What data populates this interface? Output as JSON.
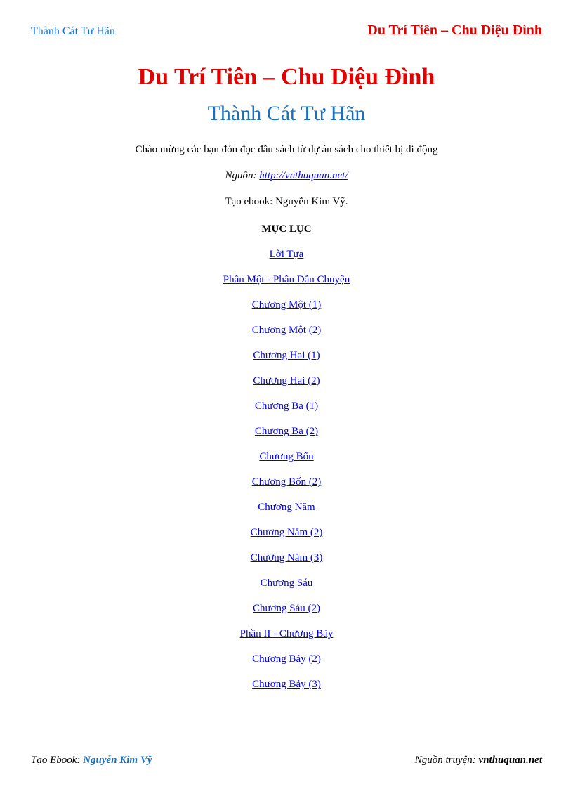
{
  "header": {
    "left": "Thành Cát Tư Hãn",
    "right": "Du Trí Tiên – Chu Diệu Đình"
  },
  "title_main": "Du Trí Tiên – Chu Diệu Đình",
  "title_sub": "Thành Cát Tư Hãn",
  "intro": "Chào mừng các bạn đón đọc đầu sách từ dự án sách cho thiết bị di động",
  "source": {
    "label": "Nguồn: ",
    "url": "http://vnthuquan.net/"
  },
  "creator": "Tạo ebook: Nguyễn Kim Vỹ.",
  "toc_heading": "MỤC LỤC",
  "toc": [
    "Lời Tựa",
    "Phần Một - Phần Dẫn Chuyện",
    "Chương Một (1)",
    "Chương Một (2)",
    "Chương Hai (1)",
    "Chương Hai (2)",
    "Chương Ba (1)",
    "Chương Ba (2)",
    "Chương Bốn",
    "Chương Bốn (2)",
    "Chương Năm",
    "Chương Năm (2)",
    "Chương Năm (3)",
    "Chương Sáu",
    "Chương Sáu (2)",
    "Phần II - Chương Bảy",
    "Chương Bảy (2)",
    "Chương Bảy (3)"
  ],
  "footer": {
    "left_label": "Tạo Ebook",
    "left_name": "Nguyễn Kim Vỹ",
    "right_label": "Nguồn truyện",
    "right_name": "vnthuquan.net"
  }
}
